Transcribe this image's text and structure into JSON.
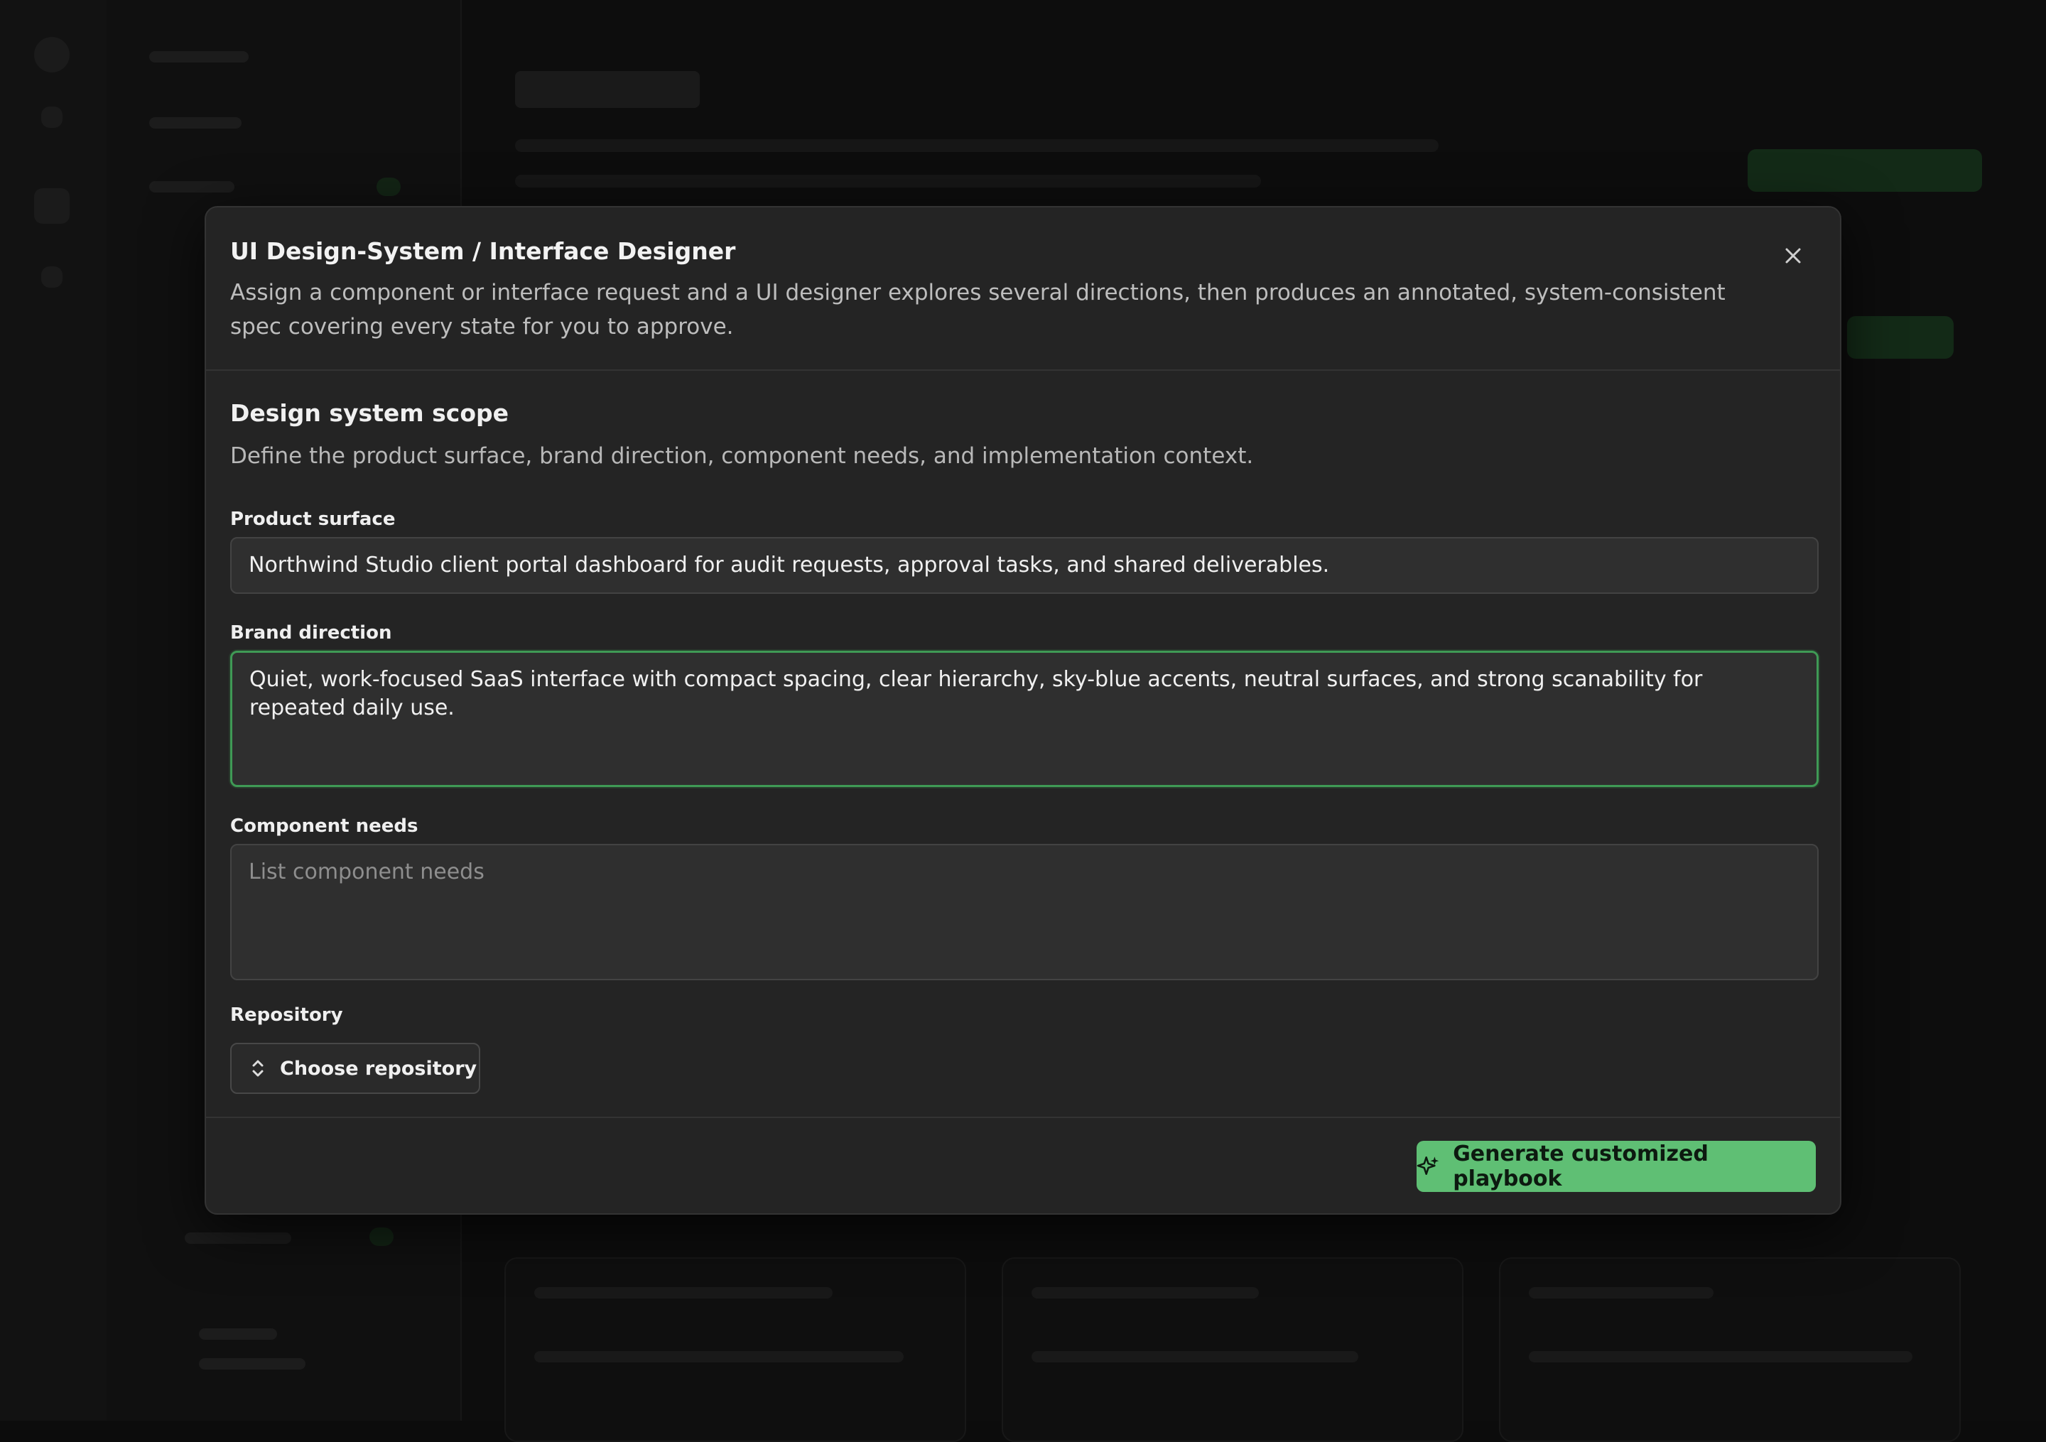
{
  "modal": {
    "title": "UI Design-System / Interface Designer",
    "description": "Assign a component or interface request and a UI designer explores several directions, then produces an annotated, system-consistent spec covering every state for you to approve.",
    "close_icon": "close-icon"
  },
  "section": {
    "title": "Design system scope",
    "description": "Define the product surface, brand direction, component needs, and implementation context."
  },
  "fields": {
    "product_surface": {
      "label": "Product surface",
      "value": "Northwind Studio client portal dashboard for audit requests, approval tasks, and shared deliverables."
    },
    "brand_direction": {
      "label": "Brand direction",
      "value": "Quiet, work-focused SaaS interface with compact spacing, clear hierarchy, sky-blue accents, neutral surfaces, and strong scanability for repeated daily use."
    },
    "component_needs": {
      "label": "Component needs",
      "value": "",
      "placeholder": "List component needs"
    },
    "repository": {
      "label": "Repository",
      "button_label": "Choose repository",
      "icon": "chevron-up-down-icon"
    }
  },
  "footer": {
    "generate_label": "Generate customized playbook",
    "generate_icon": "sparkle-icon"
  },
  "colors": {
    "accent_green": "#5fbf74",
    "focus_border": "#3f9a55",
    "modal_bg": "#242424",
    "overlay_bg": "#0c0c0c"
  }
}
